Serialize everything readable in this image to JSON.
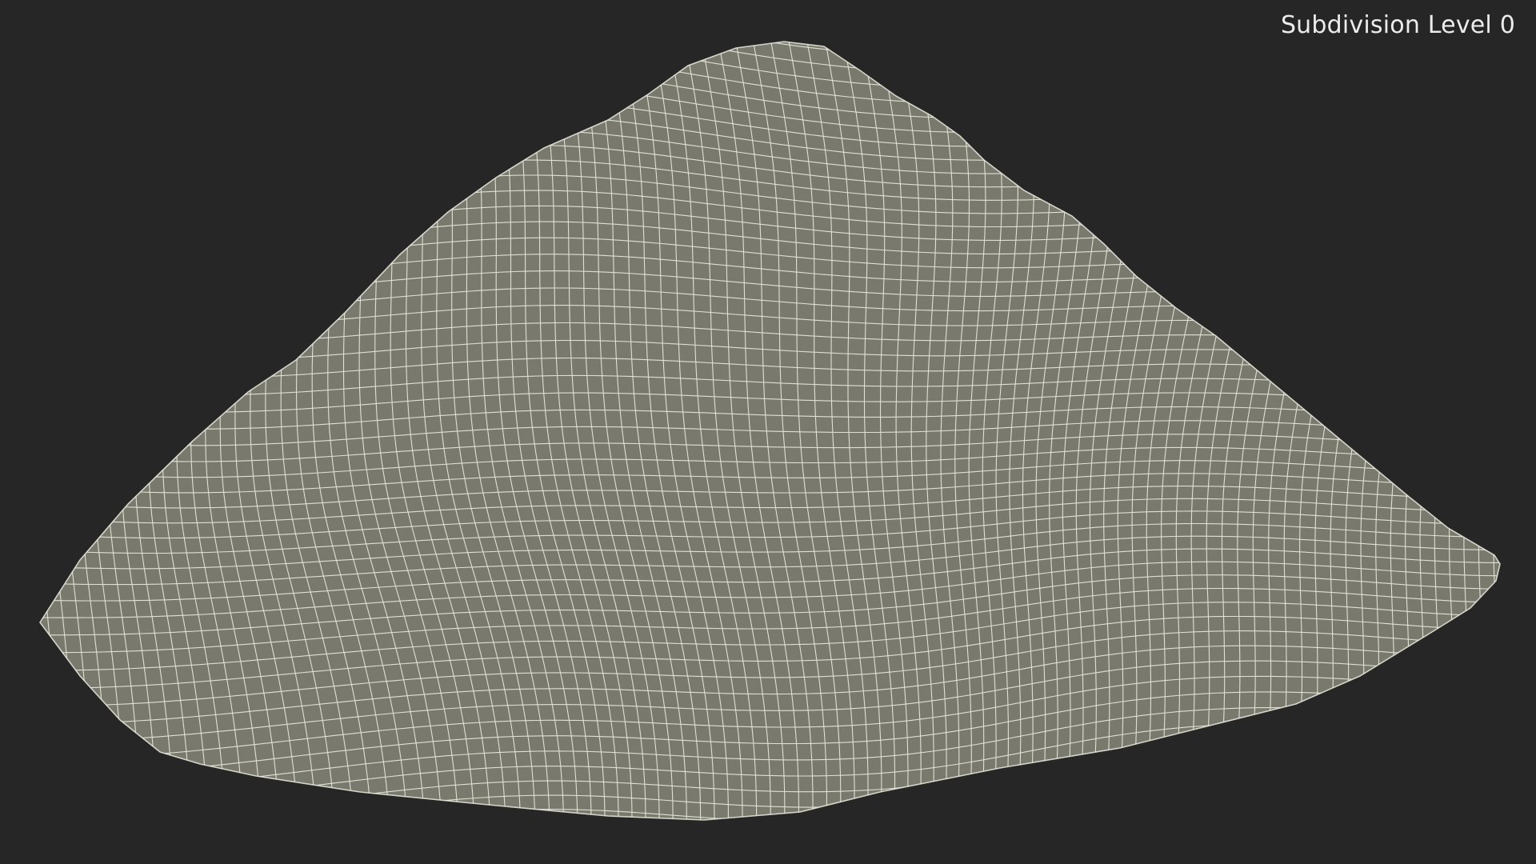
{
  "viewport": {
    "label": "Subdivision Level 0",
    "background_color": "#262626",
    "mesh_fill_color": "#797a6d",
    "mesh_wire_color": "#ecebdf"
  }
}
